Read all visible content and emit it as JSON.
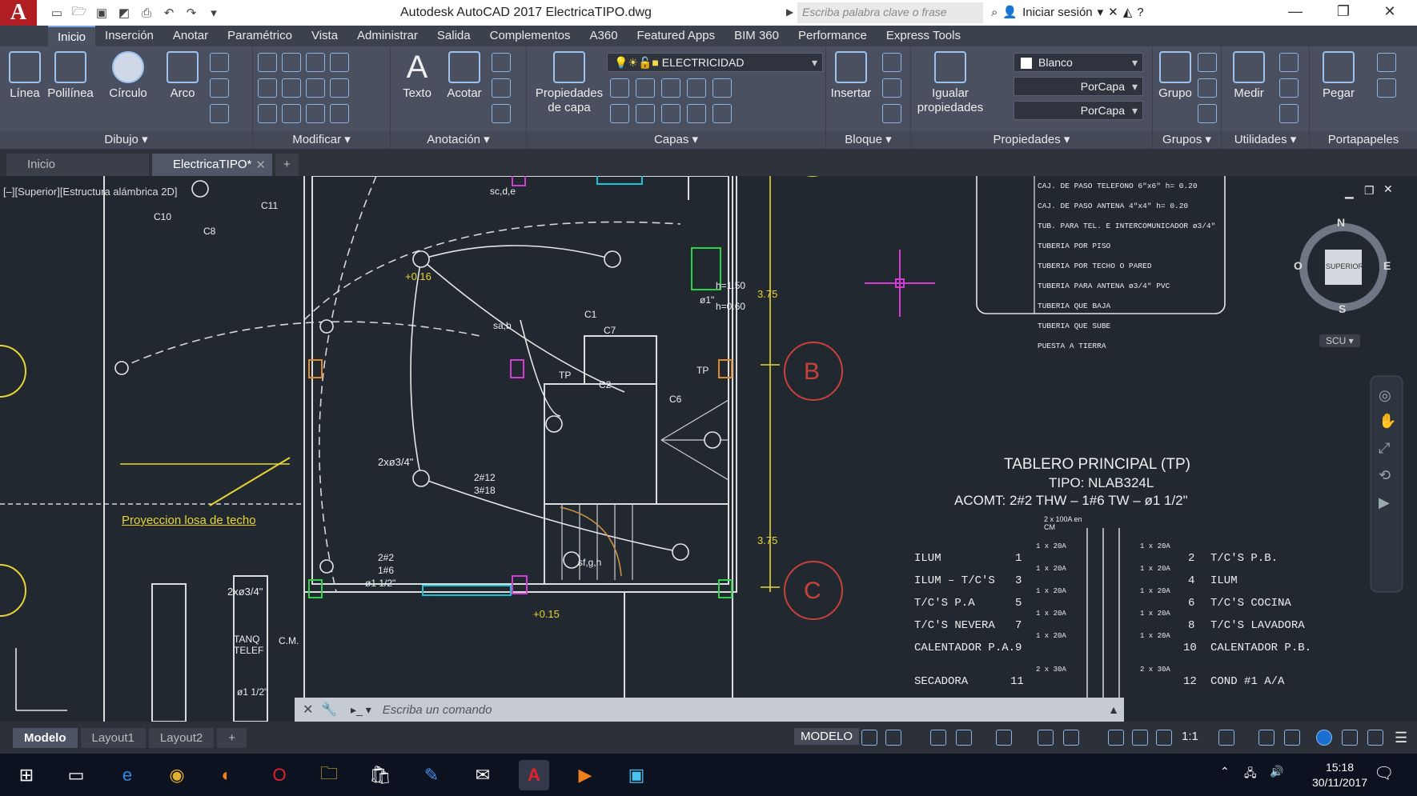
{
  "app": {
    "logo_letter": "A",
    "title": "Autodesk AutoCAD 2017   ElectricaTIPO.dwg",
    "search_placeholder": "Escriba palabra clave o frase",
    "signin_label": "Iniciar sesión"
  },
  "menu": {
    "tabs": [
      "Inicio",
      "Inserción",
      "Anotar",
      "Paramétrico",
      "Vista",
      "Administrar",
      "Salida",
      "Complementos",
      "A360",
      "Featured Apps",
      "BIM 360",
      "Performance",
      "Express Tools"
    ]
  },
  "ribbon": {
    "draw_tools": [
      "Línea",
      "Polilínea",
      "Círculo",
      "Arco"
    ],
    "panels": [
      "Dibujo",
      "Modificar",
      "Anotación",
      "Capas",
      "Bloque",
      "Propiedades",
      "Grupos",
      "Utilidades",
      "Portapapeles"
    ],
    "text_tool": "Texto",
    "dimension_tool": "Acotar",
    "layer_props_line1": "Propiedades",
    "layer_props_line2": "de capa",
    "layer_dropdown": "ELECTRICIDAD",
    "insert_tool": "Insertar",
    "match_line1": "Igualar",
    "match_line2": "propiedades",
    "color_dropdown": "Blanco",
    "linetype_dropdown": "PorCapa",
    "lineweight_dropdown": "PorCapa",
    "group_tool": "Grupo",
    "measure_tool": "Medir",
    "paste_tool": "Pegar"
  },
  "doctabs": {
    "start": "Inicio",
    "current": "ElectricaTIPO*"
  },
  "drawing": {
    "viewport_label": "[–][Superior][Estructura alámbrica 2D]",
    "compass": {
      "n": "N",
      "s": "S",
      "e": "E",
      "w": "O",
      "center": "SUPERIOR",
      "ucs": "SCU"
    },
    "legend_rows": [
      "CAJ. DE PASO TELEFONO 6\"x6\"   h= 0.20",
      "CAJ. DE PASO ANTENA 4\"x4\"   h= 0.20",
      "TUB. PARA TEL. E INTERCOMUNICADOR ø3/4\"",
      "TUBERIA POR PISO",
      "TUBERIA POR TECHO O PARED",
      "TUBERIA PARA ANTENA ø3/4\" PVC",
      "TUBERIA QUE BAJA",
      "TUBERIA QUE SUBE",
      "PUESTA A TIERRA"
    ],
    "panel_title": "TABLERO PRINCIPAL (TP)",
    "panel_type": "TIPO:  NLAB324L",
    "panel_acomt": "ACOMT:  2#2 THW  –  1#6 TW  –  ø1  1/2\"",
    "main_breaker": "2 x 100A en CM",
    "circuits_left": [
      {
        "label": "ILUM",
        "n": "1",
        "breaker": "1 x 20A"
      },
      {
        "label": "ILUM – T/C'S",
        "n": "3",
        "breaker": "1 x 20A"
      },
      {
        "label": "T/C'S P.A",
        "n": "5",
        "breaker": "1 x 20A"
      },
      {
        "label": "T/C'S NEVERA",
        "n": "7",
        "breaker": "1 x 20A"
      },
      {
        "label": "CALENTADOR P.A.",
        "n": "9",
        "breaker": "1 x 20A"
      },
      {
        "label": "SECADORA",
        "n": "11",
        "breaker": "2 x 30A"
      }
    ],
    "circuits_right": [
      {
        "label": "T/C'S P.B.",
        "n": "2",
        "breaker": "1 x 20A"
      },
      {
        "label": "ILUM",
        "n": "4",
        "breaker": "1 x 20A"
      },
      {
        "label": "T/C'S COCINA",
        "n": "6",
        "breaker": "1 x 20A"
      },
      {
        "label": "T/C'S LAVADORA",
        "n": "8",
        "breaker": "1 x 20A"
      },
      {
        "label": "CALENTADOR P.B.",
        "n": "10",
        "breaker": "1 x 20A"
      },
      {
        "label": "COND #1 A/A",
        "n": "12",
        "breaker": "2 x 30A"
      }
    ],
    "annotations": {
      "slab_projection": "Proyeccion losa de techo",
      "dim_375a": "3.75",
      "dim_375b": "3.75",
      "level_a": "+0.16",
      "level_b": "+0.15",
      "h150": "h=1.50",
      "h060": "h=0.60",
      "conduit_a": "2xø3/4\"",
      "conduit_b": "2xø3/4\"",
      "cable_a": "2#12",
      "cable_b": "3#18",
      "cable_c": "2#2",
      "cable_d": "1#6",
      "cable_e": "ø1  1/2\"",
      "tp_a": "TP",
      "tp_b": "TP",
      "phone_a": "TANQ",
      "phone_b": "TELEF",
      "axis_b": "B",
      "axis_c": "C",
      "c10": "C10",
      "c11": "C11",
      "c8": "C8",
      "c7": "C7",
      "c1": "C1",
      "c6": "C6",
      "c2": "C2",
      "sc": "sc,d,e",
      "sab": "sa,b",
      "sfgh": "sf,g,h",
      "phi1": "ø1\"",
      "ground": "ø1  1/2\"",
      "cm": "C.M."
    }
  },
  "cmdline": {
    "placeholder": "Escriba un comando"
  },
  "layout_tabs": [
    "Modelo",
    "Layout1",
    "Layout2"
  ],
  "status": {
    "model": "MODELO",
    "scale": "1:1"
  },
  "taskbar": {
    "time": "15:18",
    "date": "30/11/2017"
  }
}
